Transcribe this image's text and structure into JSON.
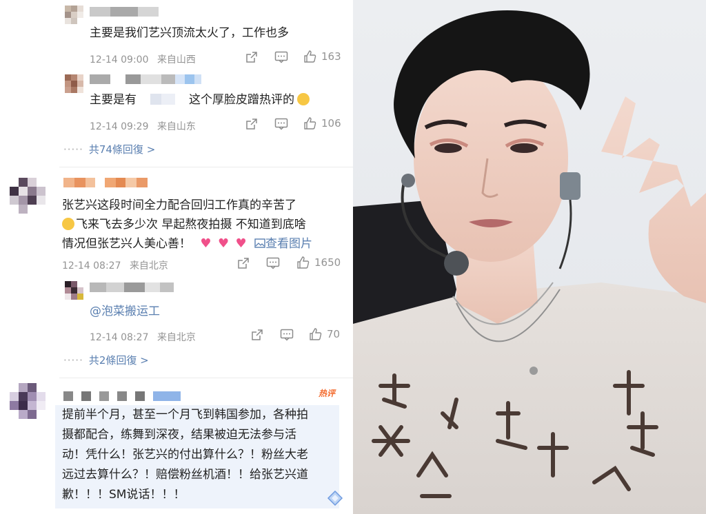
{
  "comments": [
    {
      "text": "主要是我们艺兴顶流太火了，工作也多",
      "time": "12-14 09:00",
      "location": "来自山西",
      "likes": "163"
    },
    {
      "text_before": "主要是有",
      "text_after": "这个厚脸皮蹭热评的",
      "time": "12-14 09:29",
      "location": "来自山东",
      "likes": "106"
    },
    {
      "more": "共74條回復 >"
    },
    {
      "lines": [
        "张艺兴这段时间全力配合回归工作真的辛苦了",
        "飞来飞去多少次 早起熬夜拍摄 不知道到底啥",
        "情况但张艺兴人美心善！"
      ],
      "view_image": "查看图片",
      "time": "12-14 08:27",
      "location": "来自北京",
      "likes": "1650"
    },
    {
      "mention": "@泡菜搬运工",
      "time": "12-14 08:27",
      "location": "来自北京",
      "likes": "70"
    },
    {
      "more": "共2條回復 >"
    },
    {
      "hot_label": "热评",
      "lines": [
        "提前半个月，甚至一个月飞到韩国参加，各种拍",
        "摄都配合，练舞到深夜，结果被迫无法参与活",
        "动！凭什么！张艺兴的付出算什么？！粉丝大老",
        "远过去算什么？！赔偿粉丝机酒！！给张艺兴道",
        "歉！！！SM说话！！！"
      ]
    }
  ],
  "icons": {
    "share": "share-icon",
    "comment": "comment-icon",
    "like": "thumbs-up-icon",
    "emoji_laugh": "grinning-face-emoji",
    "emoji_cry": "crying-face-emoji",
    "emoji_heart": "heart-emoji",
    "image": "image-icon"
  },
  "colors": {
    "link": "#5a7fb0",
    "meta": "#939393",
    "hot": "#f36b2e",
    "hot_bg": "#eef3fb"
  }
}
